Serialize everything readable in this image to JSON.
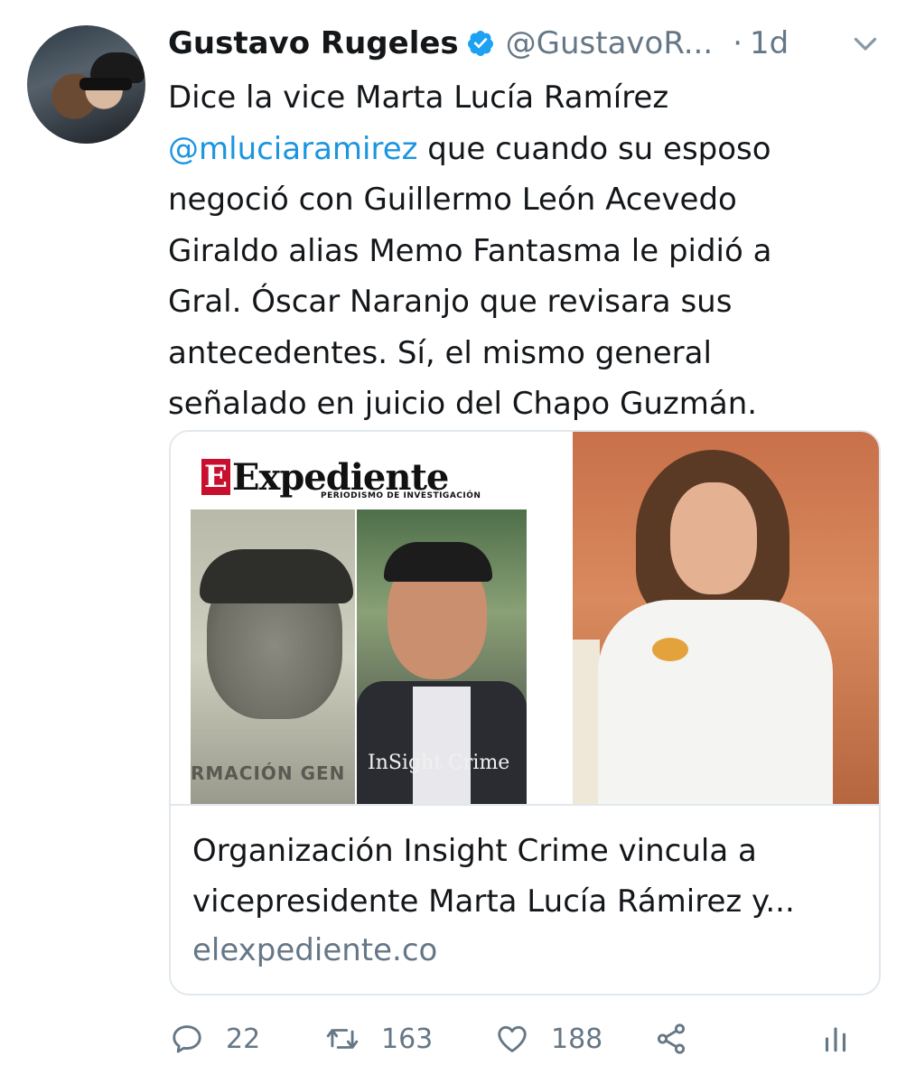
{
  "tweet": {
    "author_name": "Gustavo Rugeles",
    "handle": "@GustavoR...",
    "separator": "·",
    "time": "1d",
    "text_line_1": "Dice la vice Marta Lucía Ramírez",
    "mention": "@mluciaramirez",
    "text_line_2_rest": " que cuando su esposo",
    "text_line_3": "negoció con Guillermo León Acevedo",
    "text_line_4": "Giraldo alias Memo Fantasma le pidió a",
    "text_line_5": "Gral. Óscar Naranjo que revisara sus",
    "text_line_6": "antecedentes. Sí, el mismo general",
    "text_line_7": "señalado en juicio del Chapo Guzmán."
  },
  "card": {
    "brand_mark": "E",
    "brand_word": "Expediente",
    "brand_tagline": "PERIODISMO DE INVESTIGACIÓN",
    "photo1_caption": "RMACIÓN GEN",
    "photo2_watermark": "InSight Crime",
    "title_line_1": "Organización Insight Crime vincula a",
    "title_line_2": "vicepresidente Marta Lucía Rámirez y...",
    "domain": "elexpediente.co"
  },
  "actions": {
    "reply_count": "22",
    "retweet_count": "163",
    "like_count": "188"
  },
  "icons": {
    "verified": "verified-badge-icon",
    "chevron": "chevron-down-icon",
    "reply": "reply-icon",
    "retweet": "retweet-icon",
    "like": "heart-icon",
    "share": "share-icon",
    "stats": "analytics-icon"
  },
  "colors": {
    "text": "#14171a",
    "secondary": "#657786",
    "link": "#1b95e0",
    "verified": "#1da1f2",
    "border": "#e1e8ed",
    "brand_red": "#c8102e"
  }
}
